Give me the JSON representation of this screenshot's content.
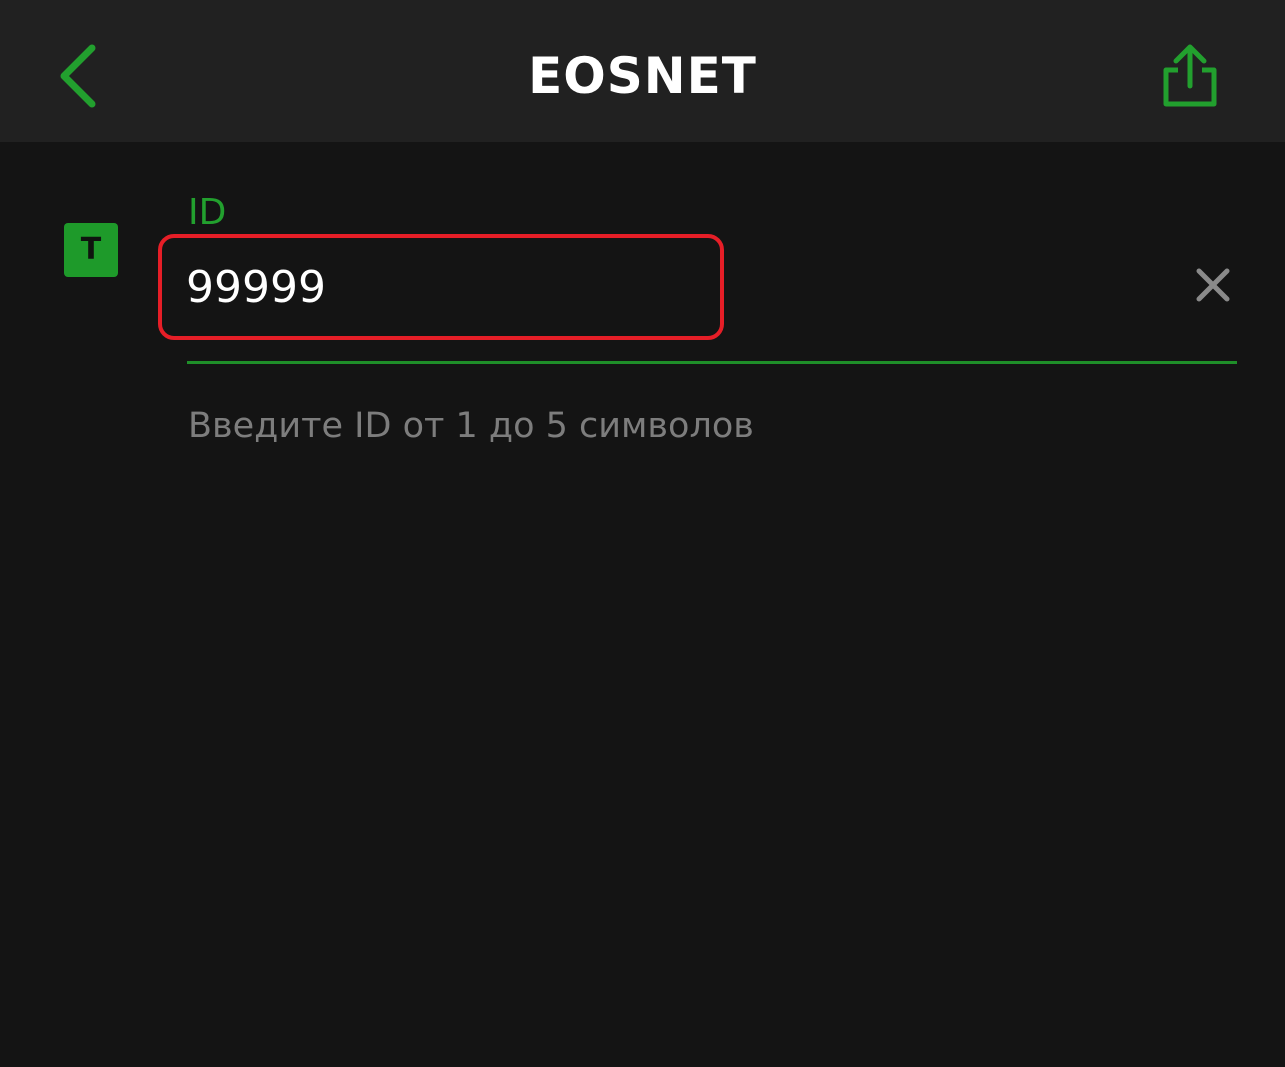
{
  "nav": {
    "title": "EOSNET",
    "back_icon": "chevron-left-icon",
    "share_icon": "share-icon"
  },
  "field": {
    "type_badge": "T",
    "label": "ID",
    "value": "99999",
    "helper": "Введите ID от 1 до 5 символов",
    "clear_icon": "close-icon"
  },
  "colors": {
    "accent": "#22a02e",
    "highlight_border": "#e61e27",
    "background": "#141414",
    "nav_background": "#212121",
    "helper_text": "#7d7d7d"
  }
}
